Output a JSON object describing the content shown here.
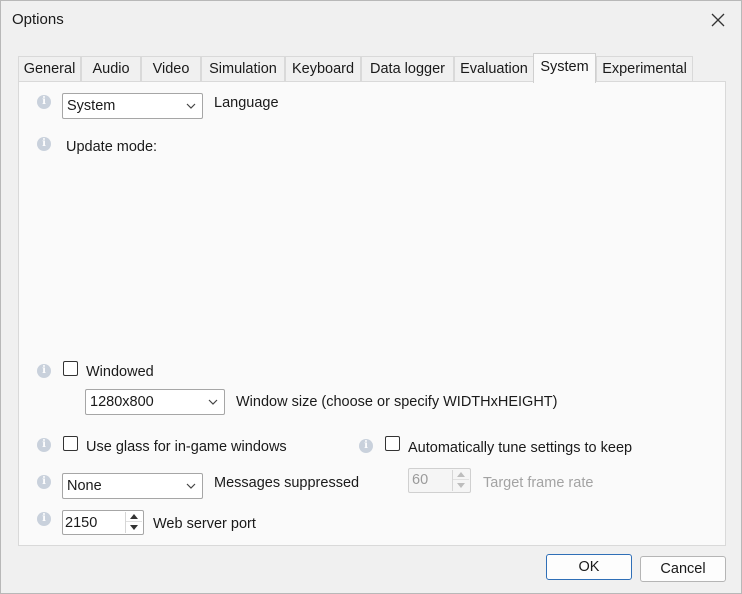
{
  "window": {
    "title": "Options"
  },
  "tabs": [
    {
      "label": "General"
    },
    {
      "label": "Audio"
    },
    {
      "label": "Video"
    },
    {
      "label": "Simulation"
    },
    {
      "label": "Keyboard"
    },
    {
      "label": "Data logger"
    },
    {
      "label": "Evaluation"
    },
    {
      "label": "System",
      "active": true
    },
    {
      "label": "Experimental"
    }
  ],
  "system": {
    "language": {
      "value": "System",
      "label": "Language"
    },
    "update_mode": {
      "label": "Update mode:"
    },
    "windowed": {
      "label": "Windowed",
      "checked": false
    },
    "window_size": {
      "value": "1280x800",
      "label": "Window size (choose or specify WIDTHxHEIGHT)"
    },
    "use_glass": {
      "label": "Use glass for in-game windows",
      "checked": false
    },
    "auto_tune": {
      "label": "Automatically tune settings to keep",
      "checked": false
    },
    "messages_suppressed": {
      "value": "None",
      "label": "Messages suppressed"
    },
    "target_frame_rate": {
      "value": "60",
      "label": "Target frame rate",
      "enabled": false
    },
    "web_server_port": {
      "value": "2150",
      "label": "Web server port"
    }
  },
  "buttons": {
    "ok": "OK",
    "cancel": "Cancel"
  },
  "icons": {
    "close": "close-icon",
    "info": "info-icon",
    "dropdown": "chevron-down-icon",
    "spin_up": "spin-up-icon",
    "spin_down": "spin-down-icon"
  },
  "colors": {
    "accent": "#2f6fb7",
    "info_icon": "#c9d1dc",
    "panel_bg": "#fafafa",
    "window_bg": "#f0f0f0"
  }
}
